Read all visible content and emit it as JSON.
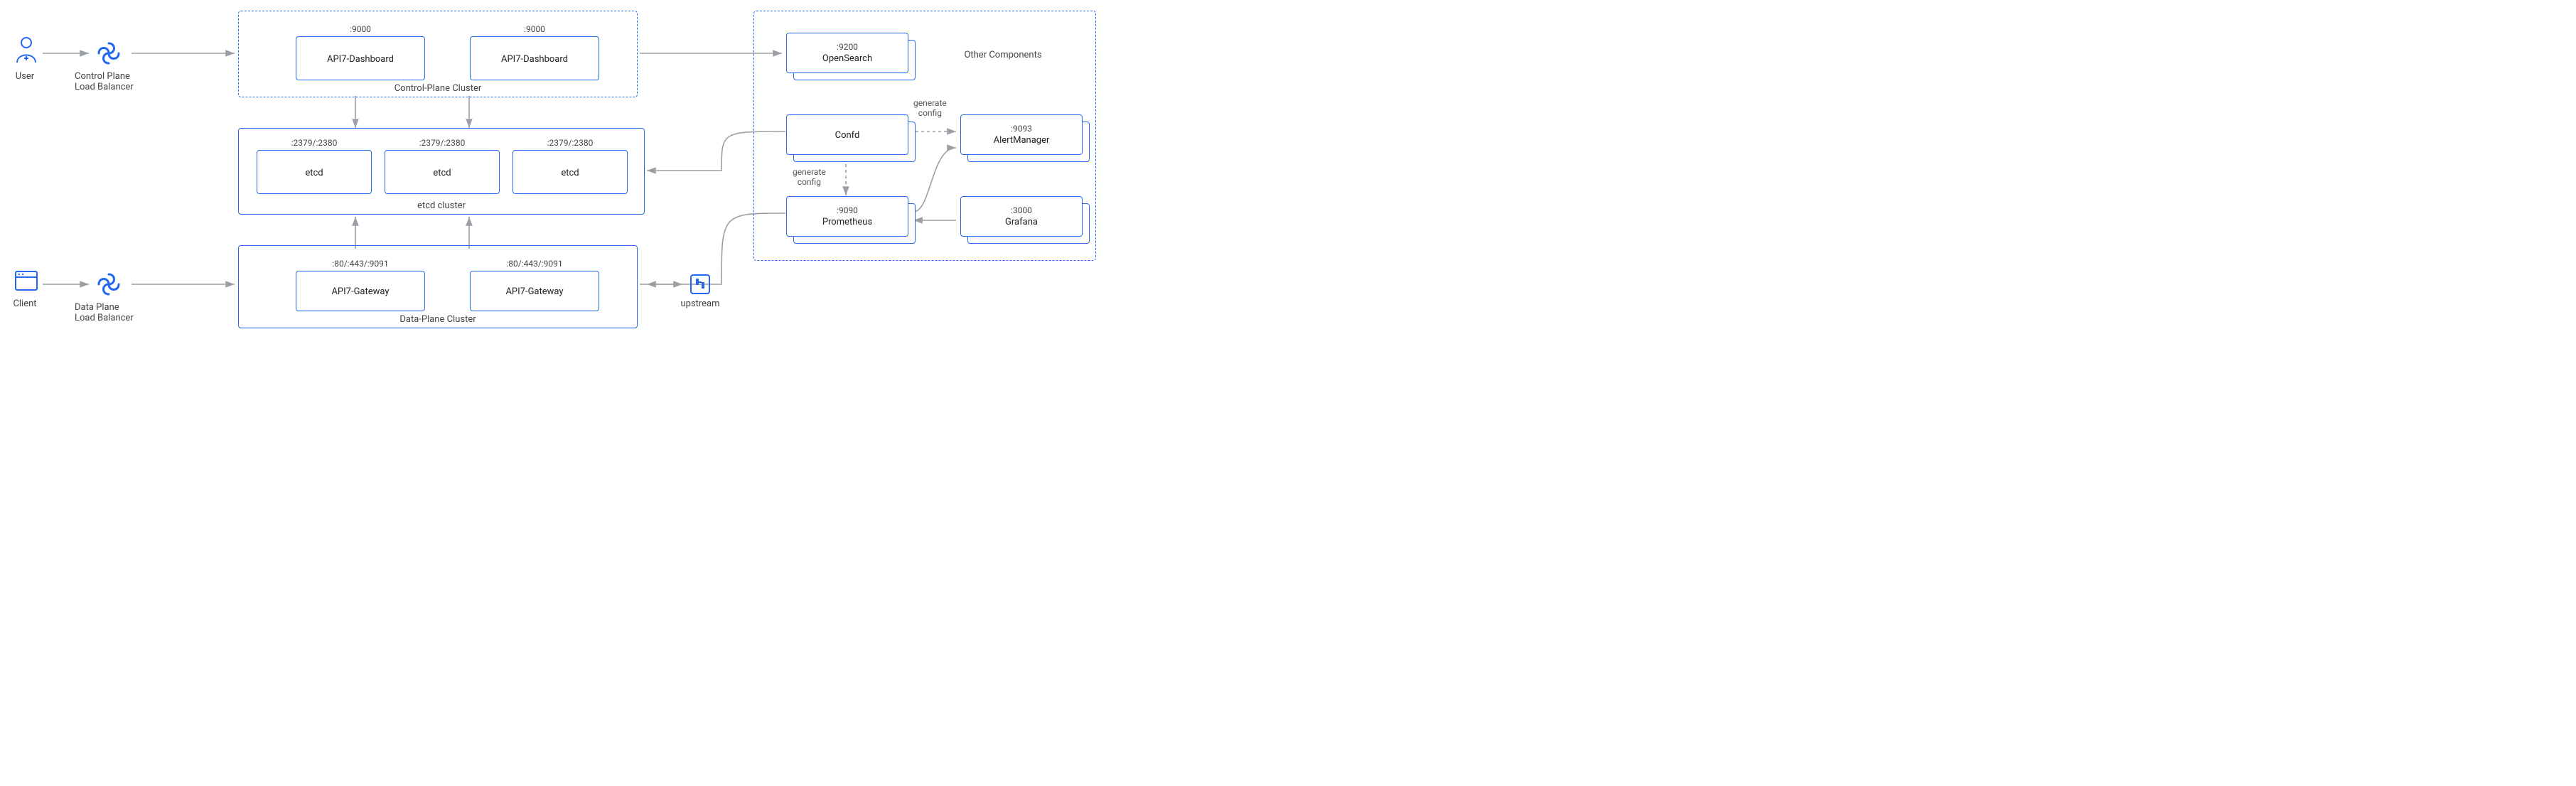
{
  "actors": {
    "user": "User",
    "client": "Client",
    "control_lb": "Control Plane\nLoad Balancer",
    "data_lb": "Data Plane\nLoad Balancer",
    "upstream": "upstream"
  },
  "clusters": {
    "control_plane": {
      "label": "Control-Plane Cluster",
      "nodes": [
        {
          "port": ":9000",
          "name": "API7-Dashboard"
        },
        {
          "port": ":9000",
          "name": "API7-Dashboard"
        }
      ]
    },
    "etcd": {
      "label": "etcd cluster",
      "nodes": [
        {
          "port": ":2379/:2380",
          "name": "etcd"
        },
        {
          "port": ":2379/:2380",
          "name": "etcd"
        },
        {
          "port": ":2379/:2380",
          "name": "etcd"
        }
      ]
    },
    "data_plane": {
      "label": "Data-Plane Cluster",
      "nodes": [
        {
          "port": ":80/:443/:9091",
          "name": "API7-Gateway"
        },
        {
          "port": ":80/:443/:9091",
          "name": "API7-Gateway"
        }
      ]
    },
    "other": {
      "label": "Other  Components",
      "nodes": [
        {
          "port": ":9200",
          "name": "OpenSearch"
        },
        {
          "port": "",
          "name": "Confd"
        },
        {
          "port": ":9093",
          "name": "AlertManager"
        },
        {
          "port": ":9090",
          "name": "Prometheus"
        },
        {
          "port": ":3000",
          "name": "Grafana"
        }
      ]
    }
  },
  "edge_labels": {
    "confd_to_alert": "generate\nconfig",
    "confd_to_prom": "generate\nconfig"
  }
}
